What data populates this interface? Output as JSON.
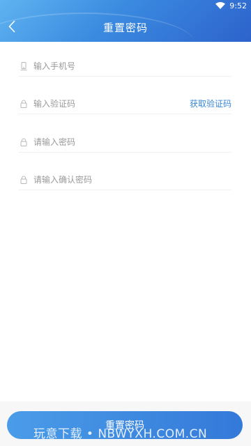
{
  "status_bar": {
    "time": "9:52",
    "wifi_icon": "wifi-icon"
  },
  "header": {
    "title": "重置密码",
    "back_icon": "chevron-left-icon"
  },
  "form": {
    "phone": {
      "placeholder": "输入手机号",
      "icon": "phone-icon"
    },
    "code": {
      "placeholder": "输入验证码",
      "icon": "lock-icon",
      "get_code_label": "获取验证码"
    },
    "password": {
      "placeholder": "请输入密码",
      "icon": "lock-icon"
    },
    "confirm_password": {
      "placeholder": "请输入确认密码",
      "icon": "lock-icon"
    }
  },
  "submit": {
    "label": "重置密码"
  },
  "watermark": {
    "text": "玩意下载 • NBWYXH.COM.CN"
  },
  "colors": {
    "header_start": "#5fb3f0",
    "header_end": "#2d63cc",
    "accent": "#3a86d8"
  }
}
